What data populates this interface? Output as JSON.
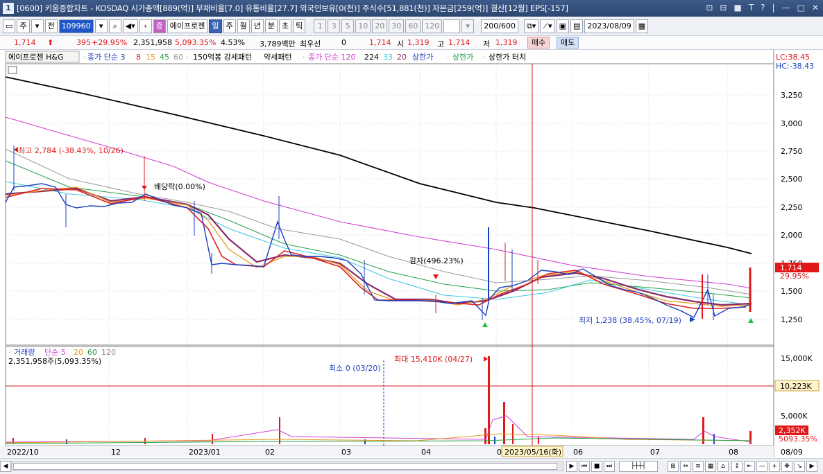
{
  "window": {
    "title": "[0600] 키움종합차트 - KOSDAQ 시가총액[889(억)] 부채비율[7.0] 유통비율[27.7] 외국인보유[0(천)] 주식수[51,881(천)] 자본금[259(억)] 결산[12월] EPS[-157]",
    "icon_label": "1",
    "controls": [
      "⊡",
      "⊟",
      "■",
      "T",
      "?",
      "|",
      "—",
      "□",
      "✕"
    ]
  },
  "toolbar": {
    "type_select": "주",
    "prev_label": "전",
    "code": "109960",
    "stock_name": "에이프로젠",
    "periods": [
      "일",
      "주",
      "월",
      "년",
      "분",
      "초",
      "틱"
    ],
    "active_period": "일",
    "minutes": [
      "1",
      "3",
      "5",
      "10",
      "20",
      "30",
      "60",
      "120"
    ],
    "count": "200",
    "count_total": "/600",
    "date": "2023/08/09"
  },
  "pricebar": {
    "price": "1,714",
    "change": "395",
    "change_pct": "+29.95%",
    "volume": "2,351,958",
    "volume_pct": "5,093.35%",
    "turnover": "4.53%",
    "amount": "3,789백만",
    "pref_label": "최우선",
    "pref_value": "0",
    "pref_price": "1,714",
    "open_label": "시",
    "open": "1,319",
    "high_label": "고",
    "high": "1,714",
    "low_label": "저",
    "low": "1,319",
    "buy": "매수",
    "sell": "매도"
  },
  "legend": {
    "name": "에이프로젠 H&G",
    "ma_label": "종가 단순 3",
    "ma": [
      "8",
      "15",
      "45",
      "60"
    ],
    "vol_ma_label": "150억봉 강세패턴",
    "weak": "약세패턴",
    "ma120": "종가 단순 120",
    "ma224": "224",
    "ma33": "33",
    "ma20": "20",
    "upper1": "상한가",
    "upper2": "상한가",
    "upper3": "상한가 터치",
    "lc": "LC:38.45",
    "hc": "HC:-38.43"
  },
  "annotations": {
    "high": "최고 2,784 (-38.43%, 10/26)",
    "dividend": "배당락(0.00%)",
    "reduction": "감자(496.23%)",
    "low": "최저 1,238 (38.45%, 07/19)",
    "price_tag": "1,714",
    "pct_tag": "29.95%"
  },
  "volume_panel": {
    "label": "거래량",
    "ma_label": "단순 5",
    "ma": [
      "20",
      "60",
      "120"
    ],
    "value": "2,351,958주(5,093.35%)",
    "min": "최소 0 (03/20)",
    "max": "최대 15,410K (04/27)",
    "axis": [
      "15,000K",
      "10,223K",
      "5,000K",
      "2,352K",
      "5093.35%"
    ]
  },
  "price_axis": [
    "3,250",
    "3,000",
    "2,750",
    "2,500",
    "2,250",
    "2,000",
    "1,750",
    "1,500",
    "1,250"
  ],
  "x_axis": [
    "2022/10",
    "12",
    "2023/01",
    "02",
    "03",
    "04",
    "05",
    "06",
    "07",
    "08",
    "08/09"
  ],
  "crosshair_date": "2023/05/16(화)",
  "colors": {
    "ma3": "#1f3fbf",
    "ma8": "#e02020",
    "ma15": "#e89a1c",
    "ma45": "#22a048",
    "ma60": "#9a9a9a",
    "ma120": "#d040d0",
    "ma224": "#000000",
    "ma33": "#3cc8e0",
    "ma20": "#8a2a6a",
    "up": "#e01818",
    "down": "#1a3fc0"
  },
  "chart_data": {
    "type": "line",
    "title": "",
    "x": [
      "2022/10",
      "12",
      "2023/01",
      "02",
      "03",
      "04",
      "05",
      "06",
      "07",
      "08"
    ],
    "close_series": [
      {
        "name": "종가",
        "x": [
          "2022/10",
          "2022/11",
          "2022/12",
          "2023/01",
          "2023/02",
          "2023/03",
          "2023/04",
          "2023/05",
          "2023/06",
          "2023/07",
          "2023/08"
        ],
        "values": [
          2330,
          2380,
          2300,
          2290,
          1720,
          1800,
          1430,
          1440,
          1720,
          1480,
          1380
        ]
      },
      {
        "name": "224",
        "x": [
          "2022/10",
          "2023/01",
          "2023/04",
          "2023/07",
          "2023/08"
        ],
        "values": [
          3400,
          2950,
          2450,
          2050,
          1840
        ]
      },
      {
        "name": "종가 단순 120",
        "x": [
          "2022/10",
          "2023/01",
          "2023/04",
          "2023/07",
          "2023/08"
        ],
        "values": [
          3050,
          2600,
          1900,
          1640,
          1520
        ]
      }
    ],
    "volume": {
      "max": "15,410K",
      "current": "2,352K"
    },
    "ylim": [
      1100,
      3450
    ]
  }
}
